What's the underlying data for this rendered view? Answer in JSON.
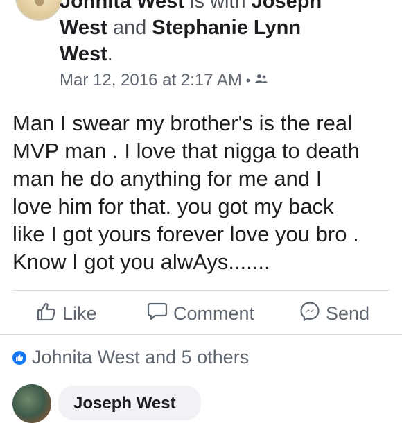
{
  "post": {
    "author_line_1": "Johnita West",
    "with_word": " is with ",
    "tag_1_part": "Joseph",
    "tag_1_cont": "West",
    "and_word": " and ",
    "tag_2": "Stephanie Lynn",
    "tag_2_cont": "West",
    "period": ".",
    "timestamp": "Mar 12, 2016 at 2:17 AM",
    "separator": "•",
    "privacy_icon": "friends-icon",
    "body_lines": [
      "Man I swear my brother's is the real",
      "MVP man . I love that nigga to death",
      "man he do anything for me and I",
      "love him for that. you got my back",
      "like I got yours forever love you bro .",
      "Know I got you alwAys......."
    ]
  },
  "actions": {
    "like_label": "Like",
    "comment_label": "Comment",
    "send_label": "Send"
  },
  "reactions": {
    "summary": "Johnita West and 5 others",
    "badge_icon": "like-badge-icon"
  },
  "comment": {
    "author": "Joseph West"
  },
  "colors": {
    "accent": "#1877f2",
    "secondary_text": "#606770"
  }
}
